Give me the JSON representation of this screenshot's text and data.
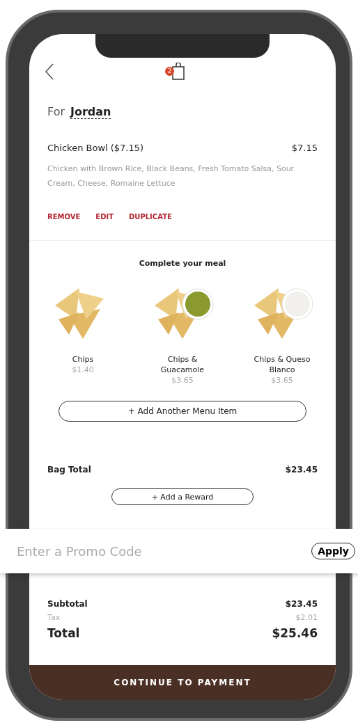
{
  "header": {
    "cart_count": "2"
  },
  "recipient": {
    "prefix": "For",
    "name": "Jordan"
  },
  "order_item": {
    "name": "Chicken Bowl ($7.15)",
    "price": "$7.15",
    "description": "Chicken with Brown Rice, Black Beans, Fresh Tomato Salsa, Sour Cream, Cheese, Romaine Lettuce",
    "actions": [
      "REMOVE",
      "EDIT",
      "DUPLICATE"
    ]
  },
  "suggestions": {
    "title": "Complete your meal",
    "items": [
      {
        "name": "Chips",
        "price": "$1.40",
        "kind": "plain"
      },
      {
        "name": "Chips & Guacamole",
        "price": "$3.65",
        "kind": "guacamole"
      },
      {
        "name": "Chips & Queso Blanco",
        "price": "$3.65",
        "kind": "queso"
      }
    ],
    "add_button": "+ Add Another Menu Item"
  },
  "bag_total": {
    "label": "Bag Total",
    "value": "$23.45"
  },
  "reward_button": "+ Add a Reward",
  "promo": {
    "placeholder": "Enter a Promo Code",
    "apply": "Apply"
  },
  "summary": [
    {
      "label": "Subtotal",
      "value": "$23.45",
      "kind": "subtotal"
    },
    {
      "label": "Tax",
      "value": "$2.01",
      "kind": "tax"
    },
    {
      "label": "Total",
      "value": "$25.46",
      "kind": "total"
    }
  ],
  "continue_button": "CONTINUE TO PAYMENT"
}
